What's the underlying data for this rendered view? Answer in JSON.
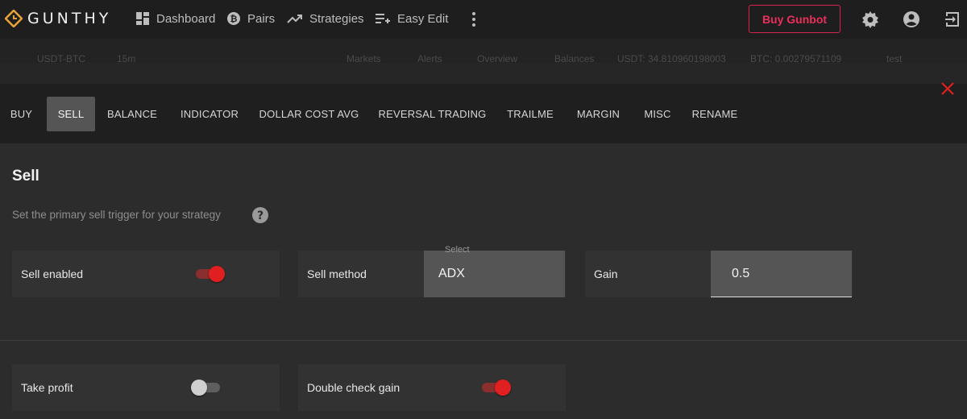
{
  "brand": {
    "name": "GUNTHY",
    "logo_icon": "gunthy-logo-icon"
  },
  "nav": [
    {
      "label": "Dashboard",
      "icon": "dashboard-icon"
    },
    {
      "label": "Pairs",
      "icon": "bitcoin-icon"
    },
    {
      "label": "Strategies",
      "icon": "trending-up-icon"
    },
    {
      "label": "Easy Edit",
      "icon": "playlist-add-icon"
    }
  ],
  "header": {
    "buy_label": "Buy Gunbot",
    "accent": "#e0234f"
  },
  "subbar": {
    "pair": "USDT-BTC",
    "interval": "15m",
    "markets": "Markets",
    "alerts": "Alerts",
    "overview": "Overview",
    "balances": "Balances",
    "usdt_balance": "USDT: 34.810960198003",
    "btc_balance": "BTC: 0.00279571109",
    "strategy": "test"
  },
  "tabs": [
    "BUY",
    "SELL",
    "BALANCE",
    "INDICATOR",
    "DOLLAR COST AVG",
    "REVERSAL TRADING",
    "TRAILME",
    "MARGIN",
    "MISC",
    "RENAME"
  ],
  "active_tab": "SELL",
  "section": {
    "title": "Sell",
    "description": "Set the primary sell trigger for your strategy"
  },
  "settings": {
    "sell_enabled": {
      "label": "Sell enabled",
      "value": true
    },
    "sell_method": {
      "label": "Sell method",
      "caption": "Select",
      "value": "ADX"
    },
    "gain": {
      "label": "Gain",
      "value": "0.5"
    },
    "take_profit": {
      "label": "Take profit",
      "value": false
    },
    "double_check_gain": {
      "label": "Double check gain",
      "value": true
    }
  },
  "colors": {
    "toggle_on": "#e02020",
    "close": "#e02020"
  }
}
